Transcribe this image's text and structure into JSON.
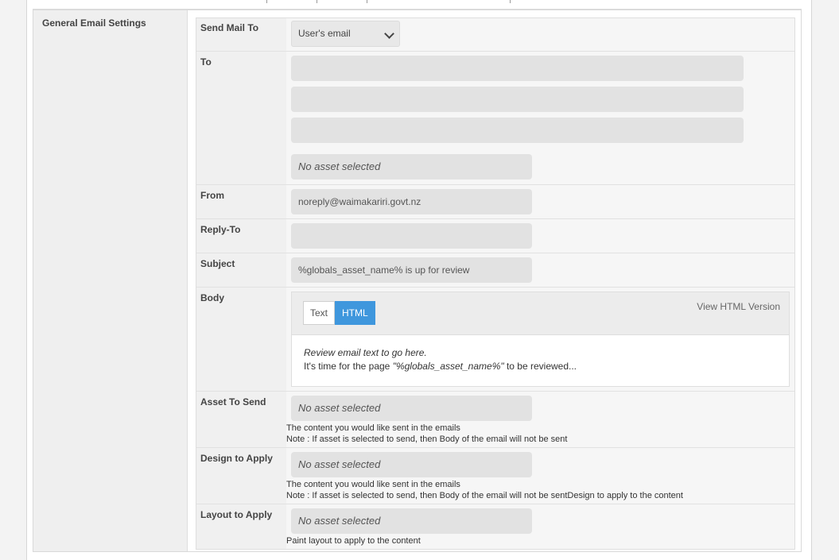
{
  "section": {
    "label": "General Email Settings"
  },
  "rows": {
    "send_mail_to": {
      "label": "Send Mail To",
      "value": "User's email"
    },
    "to": {
      "label": "To",
      "asset": "No asset selected"
    },
    "from": {
      "label": "From",
      "value": "noreply@waimakariri.govt.nz"
    },
    "reply_to": {
      "label": "Reply-To",
      "value": ""
    },
    "subject": {
      "label": "Subject",
      "value": "%globals_asset_name% is up for review"
    },
    "body": {
      "label": "Body",
      "tab_text": "Text",
      "tab_html": "HTML",
      "view_html": "View HTML Version",
      "line1": "Review email text to go here.",
      "line2_pre": "It's time for the page ",
      "line2_var": "\"%globals_asset_name%\"",
      "line2_post": " to be reviewed..."
    },
    "asset_to_send": {
      "label": "Asset To Send",
      "asset": "No asset selected",
      "note1": "The content you would like sent in the emails",
      "note2": "Note : If asset is selected to send, then Body of the email will not be sent"
    },
    "design_to_apply": {
      "label": "Design to Apply",
      "asset": "No asset selected",
      "note1": "The content you would like sent in the emails",
      "note2": "Note : If asset is selected to send, then Body of the email will not be sentDesign to apply to the content"
    },
    "layout_to_apply": {
      "label": "Layout to Apply",
      "asset": "No asset selected",
      "note1": "Paint layout to apply to the content"
    }
  },
  "colors": {
    "accent": "#3f97dd",
    "field_bg": "#e2e2e2",
    "label_bg": "#f0f0f0"
  },
  "icons": {
    "select_caret": "chevron-down-icon"
  }
}
